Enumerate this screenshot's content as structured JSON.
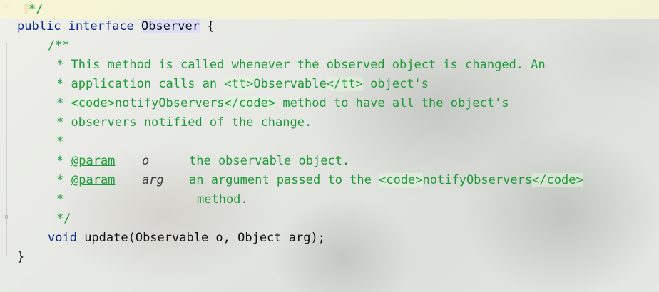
{
  "editor": {
    "line_close_comment": "*/",
    "decl": {
      "public": "public",
      "interface": "interface",
      "name": "Observer",
      "brace": "{"
    },
    "doc_open": "/**",
    "doc_lines": [
      "* This method is called whenever the observed object is changed. An",
      "* application calls an ",
      "* ",
      "* observers notified of the change.",
      "*"
    ],
    "l2_tag_open": "<tt>",
    "l2_mid": "Observable",
    "l2_tag_close": "</tt>",
    "l2_tail": " object's",
    "l3_code_open": "<code>",
    "l3_mid": "notifyObservers",
    "l3_code_close": "</code>",
    "l3_tail": " method to have all the object's",
    "param1": {
      "star": "* ",
      "tag": "@param",
      "name": "o",
      "desc": "the observable object."
    },
    "param2": {
      "star": "* ",
      "tag": "@param",
      "name": "arg",
      "desc": "an argument passed to the ",
      "code_open": "<code>",
      "code_mid": "notifyObservers",
      "code_close": "</code>"
    },
    "param2_cont": {
      "star": "*",
      "text": "method."
    },
    "doc_close": "*/",
    "method": {
      "void": "void",
      "rest": " update(Observable o, Object arg);"
    },
    "end_brace": "}"
  },
  "icons": {
    "bulb": "intention-bulb-icon",
    "fold": "fold-marker-icon"
  },
  "colors": {
    "keyword": "#0b2a8f",
    "doc_comment": "#1f9a3a",
    "current_line": "#f8f6d2"
  }
}
